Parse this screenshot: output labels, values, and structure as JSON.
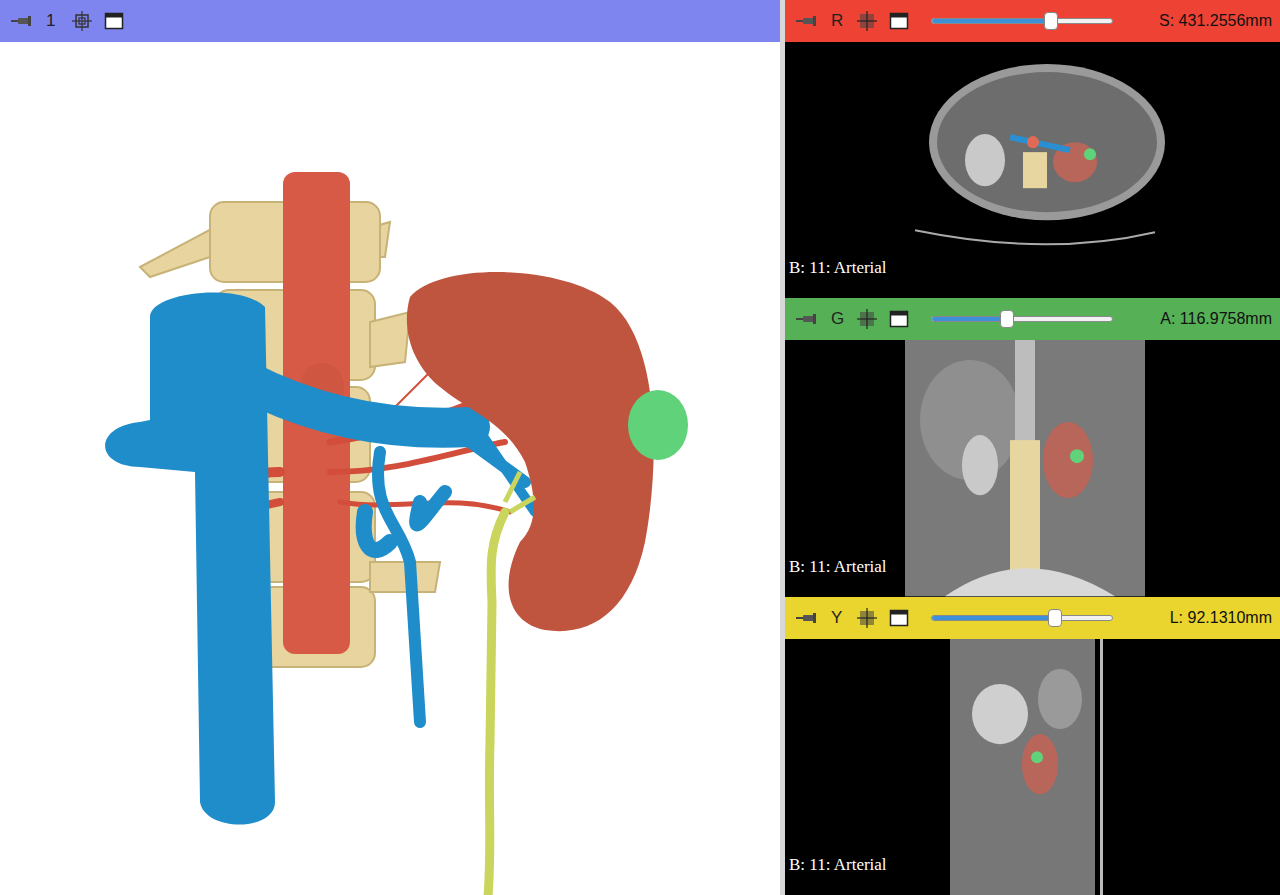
{
  "view3d": {
    "label": "1"
  },
  "slice_views": [
    {
      "name": "R",
      "color": "#ee4334",
      "offset": "S: 431.2556mm",
      "level": 0.66,
      "background": "B: 11: Arterial"
    },
    {
      "name": "G",
      "color": "#56b056",
      "offset": "A: 116.9758mm",
      "level": 0.42,
      "background": "B: 11: Arterial"
    },
    {
      "name": "Y",
      "color": "#ead52e",
      "offset": "L: 92.1310mm",
      "level": 0.68,
      "background": "B: 11: Arterial"
    }
  ]
}
